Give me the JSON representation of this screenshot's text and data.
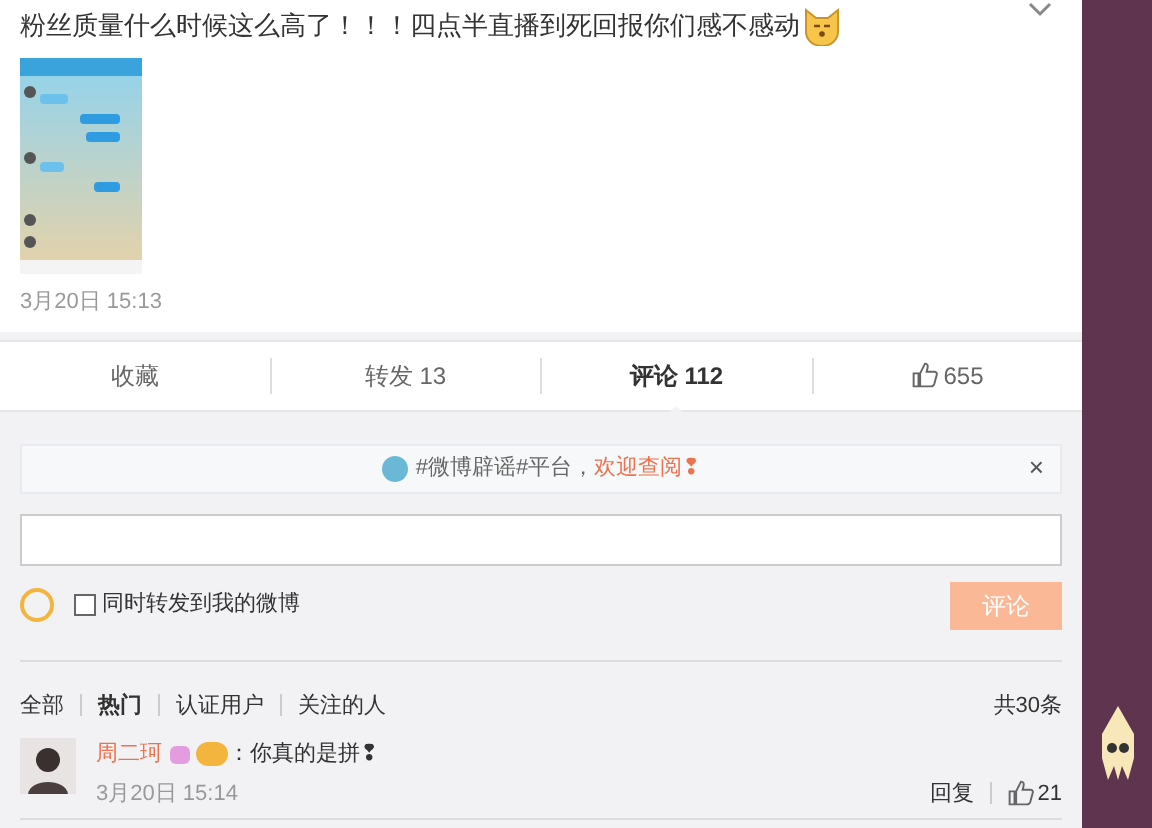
{
  "post": {
    "text": "粉丝质量什么时候这么高了！！！四点半直播到死回报你们感不感动",
    "time": "3月20日 15:13"
  },
  "actions": [
    {
      "kind": "text",
      "label": "收藏",
      "selected": false
    },
    {
      "kind": "text",
      "label": "转发 13",
      "selected": false
    },
    {
      "kind": "text",
      "label": "评论 112",
      "selected": true
    },
    {
      "kind": "like",
      "label": "655",
      "selected": false
    }
  ],
  "notice": {
    "text": "#微博辟谣#平台，",
    "link": "欢迎查阅❢",
    "close": "×"
  },
  "composer": {
    "repost_label": "同时转发到我的微博",
    "repost_checked": false,
    "submit": "评论"
  },
  "filters": [
    {
      "label": "全部",
      "selected": false
    },
    {
      "label": "热门",
      "selected": true
    },
    {
      "label": "认证用户",
      "selected": false
    },
    {
      "label": "关注的人",
      "selected": false
    }
  ],
  "total": "共30条",
  "comments": [
    {
      "user": "周二珂",
      "text": "：你真的是拼❢",
      "time": "3月20日 15:14",
      "reply": "回复",
      "likes": "21"
    }
  ]
}
